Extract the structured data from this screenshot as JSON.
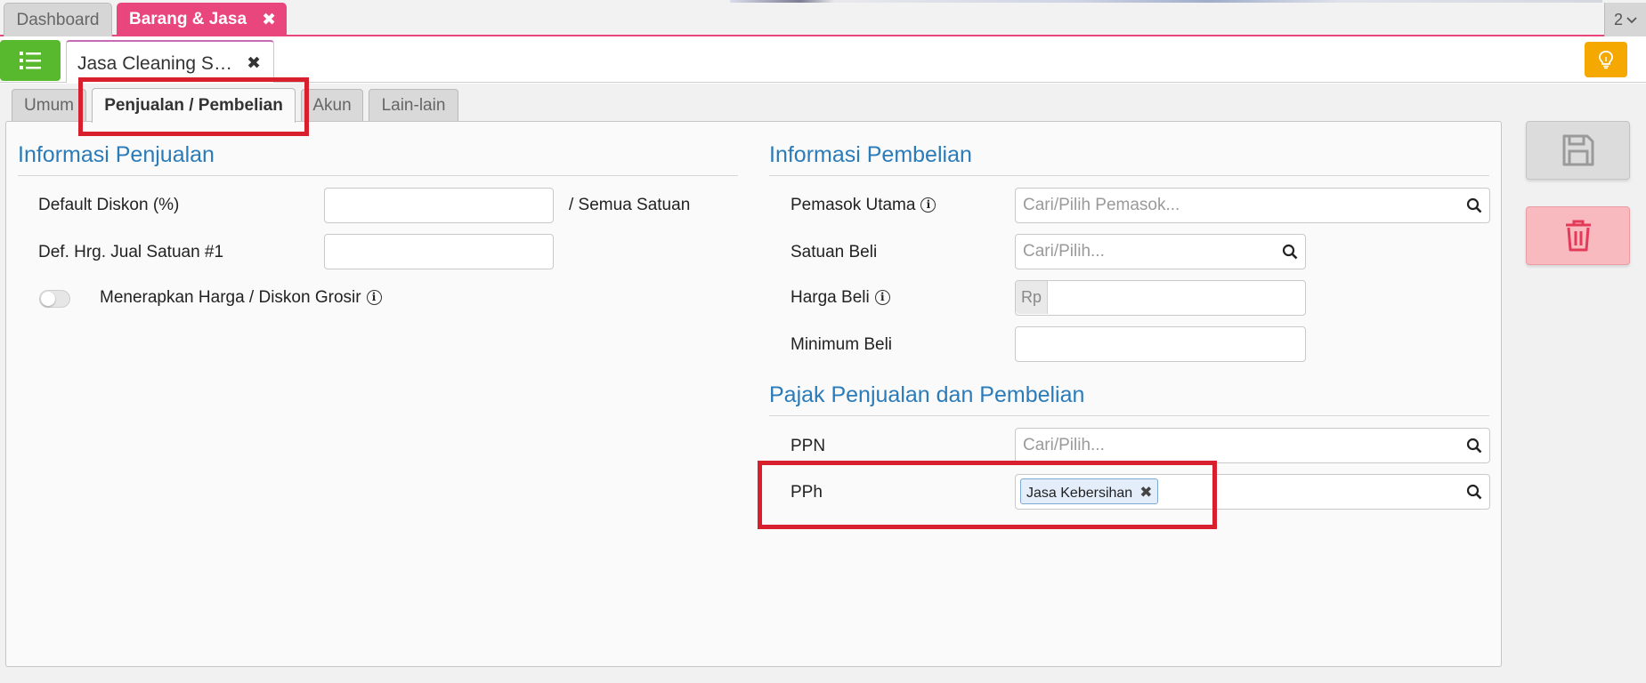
{
  "topbar": {
    "tabs": [
      {
        "label": "Dashboard"
      },
      {
        "label": "Barang & Jasa",
        "close": "✖"
      }
    ],
    "window_count": "2"
  },
  "document": {
    "tab_title": "Jasa Cleaning Se…",
    "close": "✖"
  },
  "section_tabs": [
    "Umum",
    "Penjualan / Pembelian",
    "Akun",
    "Lain-lain"
  ],
  "penjualan": {
    "title": "Informasi Penjualan",
    "default_diskon_label": "Default Diskon (%)",
    "default_diskon_value": "",
    "semua_satuan": "/ Semua Satuan",
    "harga_jual_label": "Def. Hrg. Jual Satuan #1",
    "harga_jual_value": "",
    "grosir_label": "Menerapkan Harga / Diskon Grosir",
    "grosir_enabled": false
  },
  "pembelian": {
    "title": "Informasi Pembelian",
    "pemasok_label": "Pemasok Utama",
    "pemasok_placeholder": "Cari/Pilih Pemasok...",
    "satuan_label": "Satuan Beli",
    "satuan_placeholder": "Cari/Pilih...",
    "harga_label": "Harga Beli",
    "harga_prefix": "Rp",
    "harga_value": "",
    "minimum_label": "Minimum Beli",
    "minimum_value": ""
  },
  "pajak": {
    "title": "Pajak Penjualan dan Pembelian",
    "ppn_label": "PPN",
    "ppn_placeholder": "Cari/Pilih...",
    "pph_label": "PPh",
    "pph_chip": "Jasa Kebersihan",
    "pph_chip_remove": "✖"
  },
  "icons": {
    "info": "ⓘ",
    "search": "search-icon",
    "list": "list-icon",
    "bulb": "lightbulb-icon",
    "save": "floppy-disk-icon",
    "delete": "trash-icon"
  },
  "colors": {
    "accent_pink": "#e8467c",
    "green": "#58b82e",
    "orange": "#f5a800",
    "title_blue": "#2a7bb8",
    "highlight_red": "#d71f2e",
    "delete_pink": "#f8b9bf"
  }
}
